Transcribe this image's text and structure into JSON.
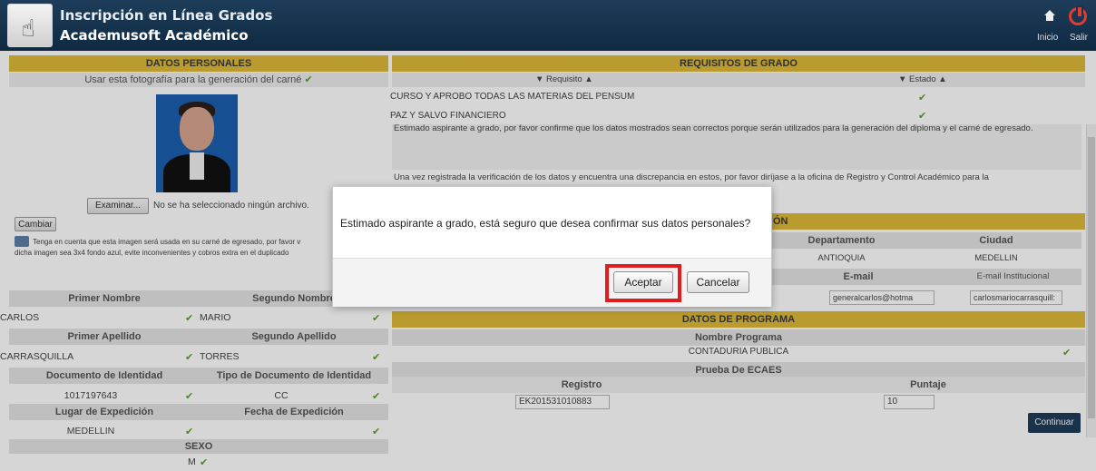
{
  "header": {
    "title": "Inscripción en Línea Grados",
    "subtitle": "Academusoft Académico",
    "inicio_label": "Inicio",
    "salir_label": "Salir"
  },
  "personal": {
    "section_title": "DATOS PERSONALES",
    "photo_use_text": "Usar esta fotografía para la generación del carné",
    "file_button": "Examinar...",
    "file_status": "No se ha seleccionado ningún archivo.",
    "change_button": "Cambiar",
    "note_line1": "Tenga en cuenta que esta imagen será usada en su carné de egresado, por favor v",
    "note_line2": "dicha imagen sea 3x4 fondo azul, evite inconvenientes y cobros extra en el duplicado",
    "primer_nombre_label": "Primer Nombre",
    "segundo_nombre_label": "Segundo Nombre",
    "primer_nombre": "CARLOS",
    "segundo_nombre": "MARIO",
    "primer_apellido_label": "Primer Apellido",
    "segundo_apellido_label": "Segundo Apellido",
    "primer_apellido": "CARRASQUILLA",
    "segundo_apellido": "TORRES",
    "doc_label": "Documento de Identidad",
    "tipo_doc_label": "Tipo de Documento de Identidad",
    "doc": "1017197643",
    "tipo_doc": "CC",
    "lugar_label": "Lugar de Expedición",
    "fecha_label": "Fecha de Expedición",
    "lugar": "MEDELLIN",
    "fecha": "",
    "sexo_label": "SEXO",
    "sexo": "M"
  },
  "requisitos": {
    "section_title": "REQUISITOS DE GRADO",
    "col_requisito": "▼ Requisito ▲",
    "col_estado": "▼ Estado ▲",
    "rows": [
      {
        "requisito": "CURSO Y APROBO TODAS LAS MATERIAS DEL PENSUM"
      },
      {
        "requisito": "PAZ Y SALVO FINANCIERO"
      }
    ],
    "notice1": "Estimado aspirante a grado, por favor confirme que los datos mostrados sean correctos porque serán utilizados para la generación del diploma y el carné de egresado.",
    "notice2": "Una vez registrada la verificación de los datos y encuentra una discrepancia en estos, por favor diríjase a la oficina de Registro y Control Académico para la"
  },
  "ubicacion": {
    "section_tail": "ÓN",
    "departamento_label": "Departamento",
    "ciudad_label": "Ciudad",
    "departamento": "ANTIOQUIA",
    "ciudad": "MEDELLIN",
    "email_label": "E-mail",
    "email_inst_label": "E-mail Institucional",
    "email": "generalcarlos@hotma",
    "email_inst": "carlosmariocarrasquill:"
  },
  "programa": {
    "section_title": "DATOS DE PROGRAMA",
    "nombre_label": "Nombre Programa",
    "nombre": "CONTADURIA PUBLICA",
    "ecaes_label": "Prueba De ECAES",
    "registro_label": "Registro",
    "puntaje_label": "Puntaje",
    "registro": "EK201531010883",
    "puntaje": "10",
    "continuar_button": "Continuar"
  },
  "dialog": {
    "message": "Estimado aspirante a grado, está seguro que desea confirmar sus datos personales?",
    "accept": "Aceptar",
    "cancel": "Cancelar"
  },
  "icons": {
    "check": "check-icon",
    "home": "home-icon",
    "power": "power-icon"
  },
  "colors": {
    "header": "#163651",
    "section": "#ddb93a",
    "check": "#5aa02c",
    "highlight": "#e01c1c"
  }
}
